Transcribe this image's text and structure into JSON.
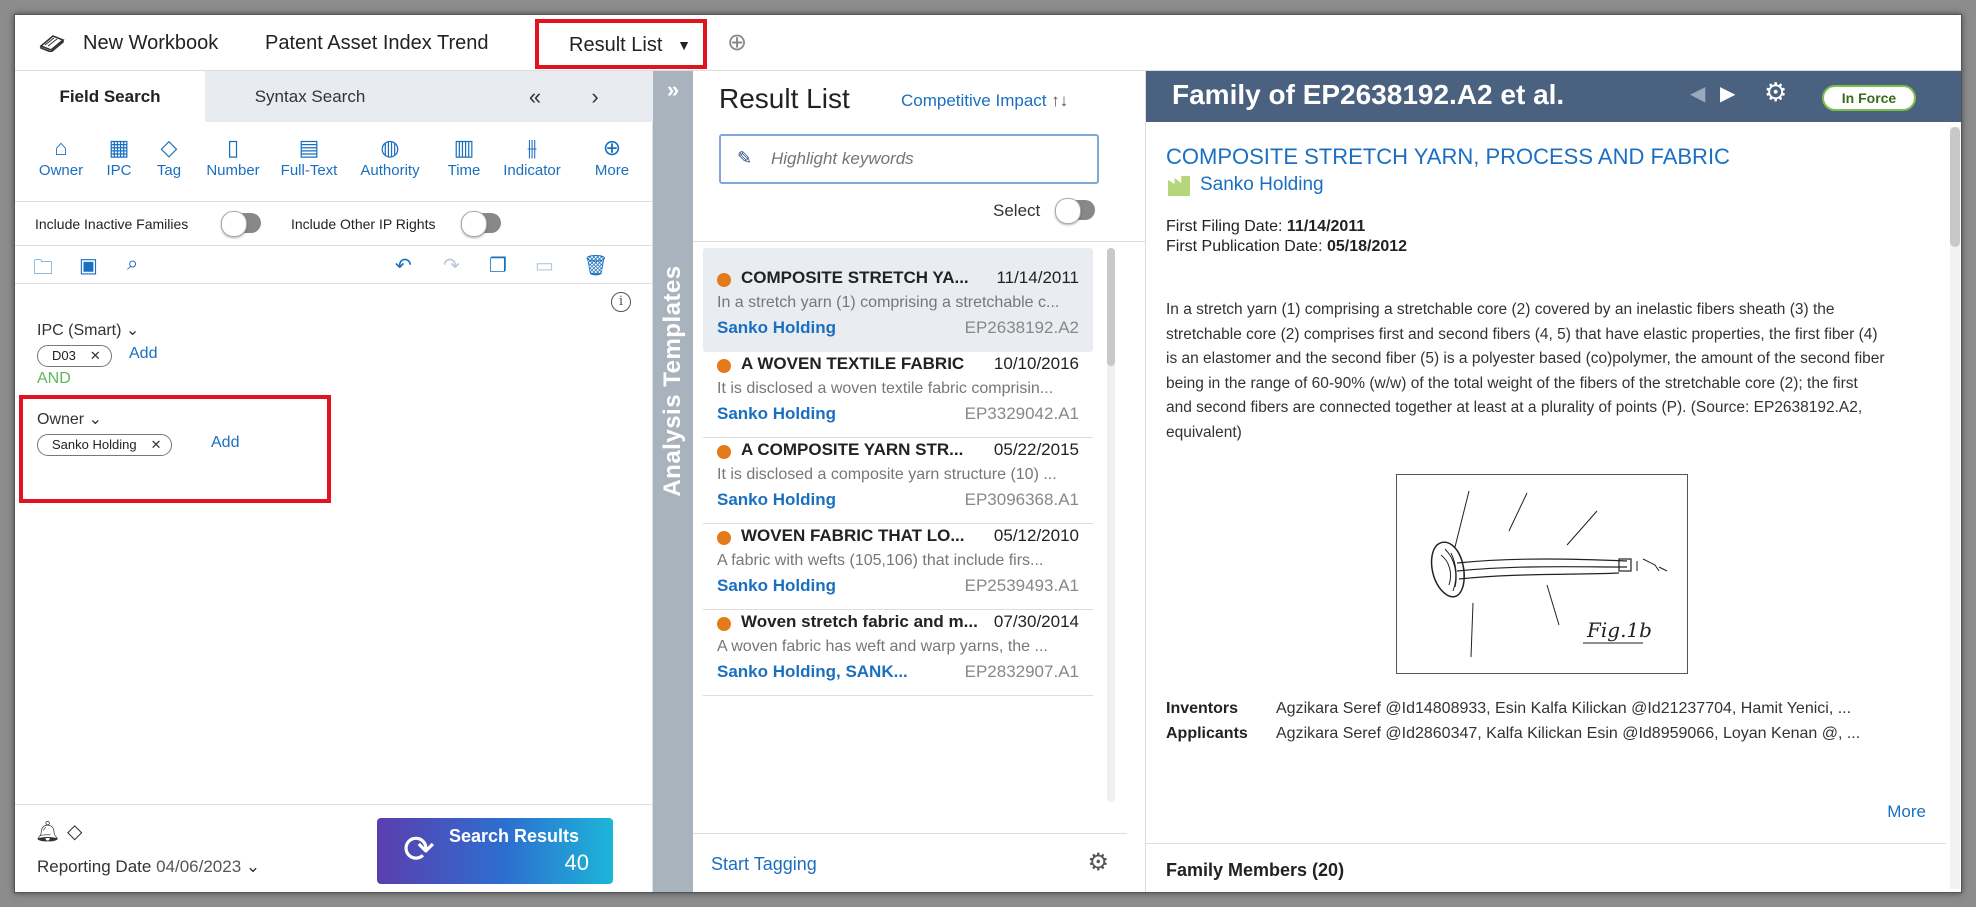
{
  "topbar": {
    "new_workbook": "New Workbook",
    "tab_pai": "Patent Asset Index Trend",
    "tab_result": "Result List"
  },
  "left": {
    "tabs": {
      "field": "Field Search",
      "syntax": "Syntax Search"
    },
    "fields": [
      "Owner",
      "IPC",
      "Tag",
      "Number",
      "Full-Text",
      "Authority",
      "Time",
      "Indicator",
      "More"
    ],
    "toggles": {
      "inactive": "Include Inactive Families",
      "other_ip": "Include Other IP Rights"
    },
    "query": {
      "ipc_label": "IPC (Smart)",
      "ipc_chip": "D03",
      "add": "Add",
      "and": "AND",
      "owner_label": "Owner",
      "owner_chip": "Sanko Holding"
    },
    "footer": {
      "reporting_label": "Reporting Date",
      "reporting_value": "04/06/2023",
      "search_label": "Search Results",
      "search_count": "40"
    }
  },
  "strip": {
    "label": "Analysis Templates"
  },
  "results": {
    "title": "Result List",
    "sort": "Competitive Impact",
    "highlight_placeholder": "Highlight keywords",
    "select_label": "Select",
    "start_tagging": "Start Tagging",
    "items": [
      {
        "title": "COMPOSITE STRETCH YA...",
        "date": "11/14/2011",
        "abstract": "In a stretch yarn (1) comprising a stretchable c...",
        "owner": "Sanko Holding",
        "number": "EP2638192.A2"
      },
      {
        "title": "A WOVEN TEXTILE FABRIC",
        "date": "10/10/2016",
        "abstract": "It is disclosed a woven textile fabric comprisin...",
        "owner": "Sanko Holding",
        "number": "EP3329042.A1"
      },
      {
        "title": "A COMPOSITE YARN STR...",
        "date": "05/22/2015",
        "abstract": "It is disclosed a composite yarn structure (10) ...",
        "owner": "Sanko Holding",
        "number": "EP3096368.A1"
      },
      {
        "title": "WOVEN FABRIC THAT LO...",
        "date": "05/12/2010",
        "abstract": "A fabric with wefts (105,106) that include firs...",
        "owner": "Sanko Holding",
        "number": "EP2539493.A1"
      },
      {
        "title": "Woven stretch fabric and m...",
        "date": "07/30/2014",
        "abstract": "A woven fabric has weft and warp yarns, the ...",
        "owner": "Sanko Holding, SANK...",
        "number": "EP2832907.A1"
      }
    ]
  },
  "detail": {
    "family_title": "Family of EP2638192.A2 et al.",
    "badge": "In Force",
    "heading": "COMPOSITE STRETCH YARN, PROCESS AND FABRIC",
    "owner": "Sanko Holding",
    "first_filing_label": "First Filing Date:",
    "first_filing_value": "11/14/2011",
    "first_pub_label": "First Publication Date:",
    "first_pub_value": "05/18/2012",
    "abstract": "In a stretch yarn (1) comprising a stretchable core (2) covered by an inelastic fibers sheath (3) the stretchable core (2) comprises first and second fibers (4, 5) that have elastic properties, the first fiber (4) is an elastomer and the second fiber (5) is a polyester based (co)polymer, the amount of the second fiber being in the range of 60-90% (w/w) of the total weight of the fibers of the stretchable core (2); the first and second fibers are connected together at least at a plurality of points (P). (Source: EP2638192.A2, equivalent)",
    "figure_label": "Fig.1b",
    "inventors_label": "Inventors",
    "inventors_value": "Agzikara Seref @Id14808933, Esin Kalfa Kilickan @Id21237704, Hamit Yenici, ...",
    "applicants_label": "Applicants",
    "applicants_value": "Agzikara Seref @Id2860347, Kalfa Kilickan Esin @Id8959066, Loyan Kenan @, ...",
    "more": "More",
    "family_members": "Family Members (20)"
  }
}
